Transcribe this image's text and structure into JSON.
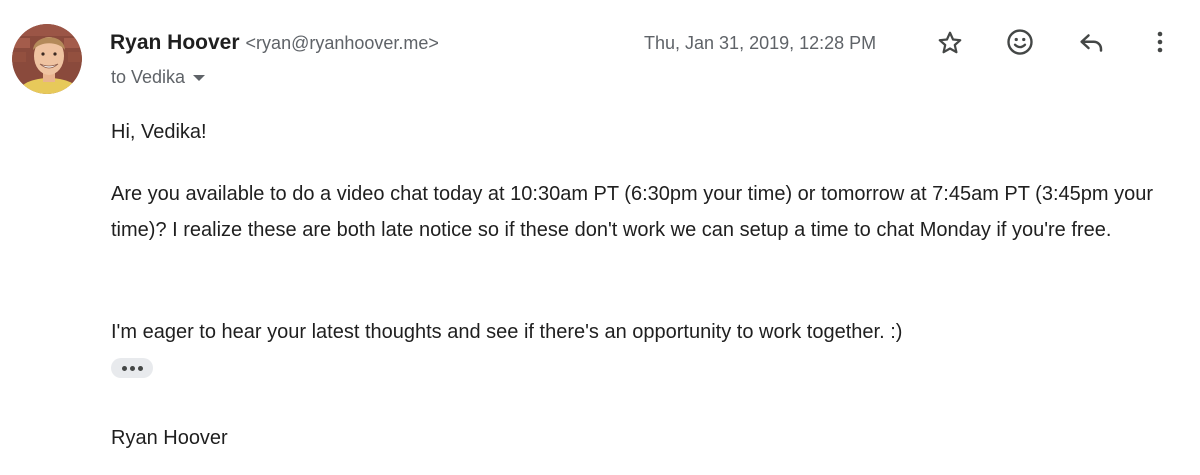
{
  "sender": {
    "name": "Ryan Hoover",
    "email": "<ryan@ryanhoover.me>"
  },
  "recipient": {
    "label": "to Vedika"
  },
  "date": "Thu, Jan 31, 2019, 12:28 PM",
  "actions": {
    "star_icon": "star-icon",
    "emoji_icon": "emoji-reaction-icon",
    "reply_icon": "reply-icon",
    "more_icon": "more-vert-icon"
  },
  "body": {
    "greeting": "Hi, Vedika!",
    "paragraph1": "Are you available to do a video chat today at 10:30am PT (6:30pm your time) or tomorrow at 7:45am PT (3:45pm your time)? I realize these are both late notice so if these don't work we can setup a time to chat Monday if you're free.",
    "paragraph2": "I'm eager to hear your latest thoughts and see if there's an opportunity to work together. :)",
    "signature": "Ryan Hoover"
  },
  "colors": {
    "text_primary": "#1f1f1f",
    "text_secondary": "#5f6368",
    "icon": "#444746",
    "trim_bg": "#e8eaed"
  }
}
